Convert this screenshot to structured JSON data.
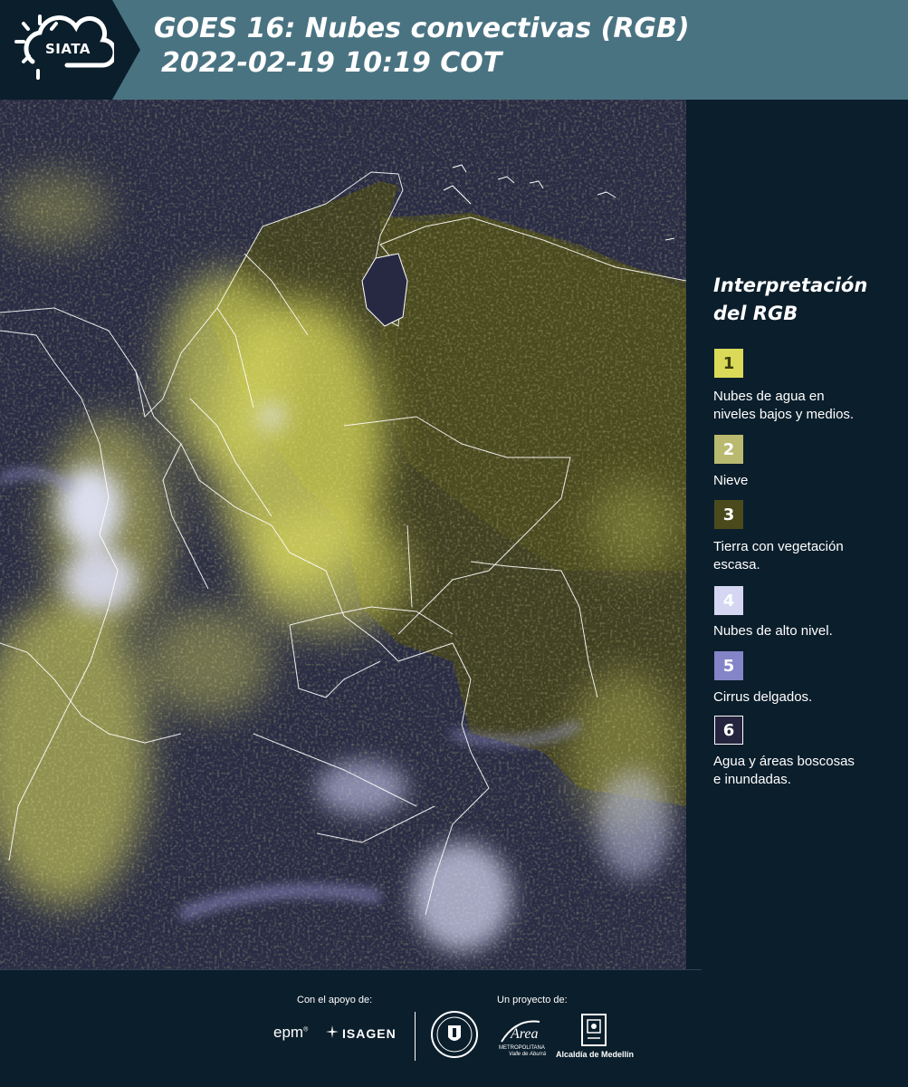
{
  "header": {
    "logo_text": "SIATA",
    "title": "GOES 16: Nubes convectivas (RGB)",
    "subtitle": "2022-02-19 10:19 COT"
  },
  "legend": {
    "title_line1": "Interpretación",
    "title_line2": "del RGB",
    "items": [
      {
        "number": "1",
        "color": "#dada58",
        "text_color": "#3a3a10",
        "label_line1": "Nubes de agua en",
        "label_line2": "niveles bajos y medios."
      },
      {
        "number": "2",
        "color": "#b9b96f",
        "text_color": "#ffffff",
        "label_line1": "Nieve",
        "label_line2": ""
      },
      {
        "number": "3",
        "color": "#4a4a1c",
        "text_color": "#ffffff",
        "label_line1": "Tierra con vegetación",
        "label_line2": "escasa."
      },
      {
        "number": "4",
        "color": "#d4d6f2",
        "text_color": "#ffffff",
        "label_line1": "Nubes de alto nivel.",
        "label_line2": ""
      },
      {
        "number": "5",
        "color": "#8484c8",
        "text_color": "#ffffff",
        "label_line1": "Cirrus delgados.",
        "label_line2": ""
      },
      {
        "number": "6",
        "color": "#24243e",
        "text_color": "#ffffff",
        "label_line1": "Agua y áreas boscosas",
        "label_line2": "e inundadas."
      }
    ]
  },
  "footer": {
    "support_label": "Con el apoyo de:",
    "project_label": "Un proyecto de:",
    "sponsor1": "epm",
    "sponsor2": "ISAGEN",
    "area_name": "Área",
    "area_sub1": "METROPOLITANA",
    "area_sub2": "Valle de Aburrá",
    "alcaldia": "Alcaldía de Medellín"
  },
  "colors": {
    "background": "#0b1e2b",
    "header": "#4a7382",
    "map_dark": "#2a2c45",
    "cloud_yellow": "#e0e060",
    "high_cloud": "#d4d6f2"
  }
}
